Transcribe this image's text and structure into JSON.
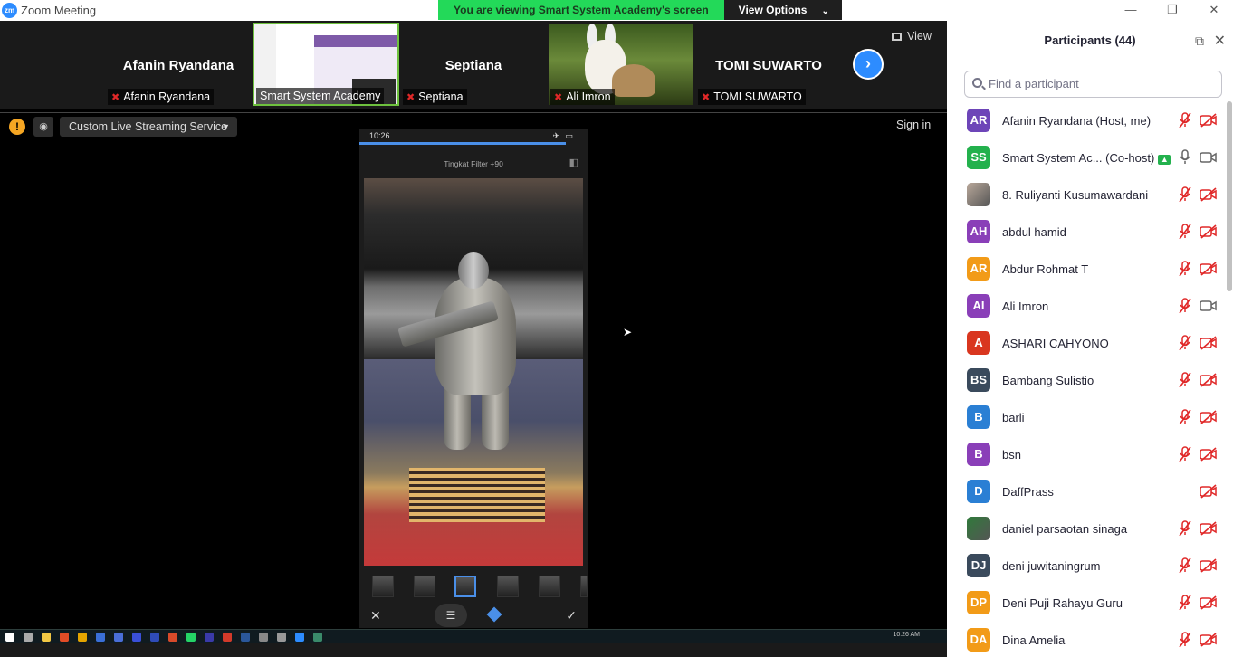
{
  "window": {
    "logo_text": "zm",
    "title": "Zoom Meeting",
    "minimize": "—",
    "restore": "❐",
    "close": "✕"
  },
  "banner": {
    "message": "You are viewing Smart System Academy's screen",
    "view_options": "View Options"
  },
  "thumbnails": [
    {
      "big_name": "Afanin Ryandana",
      "tag": "Afanin Ryandana"
    },
    {
      "big_name": "",
      "tag": "Smart System Academy"
    },
    {
      "big_name": "Septiana",
      "tag": "Septiana"
    },
    {
      "big_name": "",
      "tag": "Ali Imron"
    },
    {
      "big_name": "TOMI SUWARTO",
      "tag": "TOMI SUWARTO"
    }
  ],
  "view_label": "View",
  "share_toolbar": {
    "stream_label": "Custom Live Streaming Service",
    "signin": "Sign in"
  },
  "phone": {
    "time": "10:26",
    "filter_label": "Tingkat Filter +90"
  },
  "taskbar": {
    "clock": "10:26 AM"
  },
  "participants": {
    "title": "Participants (44)",
    "search_placeholder": "Find a participant",
    "list": [
      {
        "initials": "AR",
        "name": "Afanin Ryandana (Host, me)",
        "color": "#6d45b8",
        "mic": "muted",
        "cam": "off"
      },
      {
        "initials": "SS",
        "name": "Smart System Ac...  (Co-host)",
        "color": "#23b14d",
        "mic": "on",
        "cam": "on",
        "sharing": true
      },
      {
        "initials": "",
        "name": "8. Ruliyanti Kusumawardani",
        "color": "#b9a89a",
        "mic": "muted",
        "cam": "off",
        "photo": true
      },
      {
        "initials": "AH",
        "name": "abdul hamid",
        "color": "#8a3fb8",
        "mic": "muted",
        "cam": "off"
      },
      {
        "initials": "AR",
        "name": "Abdur Rohmat T",
        "color": "#f29b18",
        "mic": "muted",
        "cam": "off"
      },
      {
        "initials": "AI",
        "name": "Ali Imron",
        "color": "#8a3fb8",
        "mic": "muted",
        "cam": "on"
      },
      {
        "initials": "A",
        "name": "ASHARI CAHYONO",
        "color": "#d9361f",
        "mic": "muted",
        "cam": "off"
      },
      {
        "initials": "BS",
        "name": "Bambang Sulistio",
        "color": "#3a4a5c",
        "mic": "muted",
        "cam": "off"
      },
      {
        "initials": "B",
        "name": "barli",
        "color": "#2a7fd4",
        "mic": "muted",
        "cam": "off"
      },
      {
        "initials": "B",
        "name": "bsn",
        "color": "#8a3fb8",
        "mic": "muted",
        "cam": "off"
      },
      {
        "initials": "D",
        "name": "DaffPrass",
        "color": "#2a7fd4",
        "mic": "none",
        "cam": "off"
      },
      {
        "initials": "",
        "name": "daniel  parsaotan sinaga",
        "color": "#2f7a3a",
        "mic": "muted",
        "cam": "off",
        "photo": true
      },
      {
        "initials": "DJ",
        "name": "deni juwitaningrum",
        "color": "#3a4a5c",
        "mic": "muted",
        "cam": "off"
      },
      {
        "initials": "DP",
        "name": "Deni Puji Rahayu Guru",
        "color": "#f29b18",
        "mic": "muted",
        "cam": "off"
      },
      {
        "initials": "DA",
        "name": "Dina Amelia",
        "color": "#f29b18",
        "mic": "muted",
        "cam": "off"
      }
    ]
  },
  "colors": {
    "accent": "#2d8cff",
    "banner_green": "#23d959",
    "muted_red": "#e02828"
  }
}
